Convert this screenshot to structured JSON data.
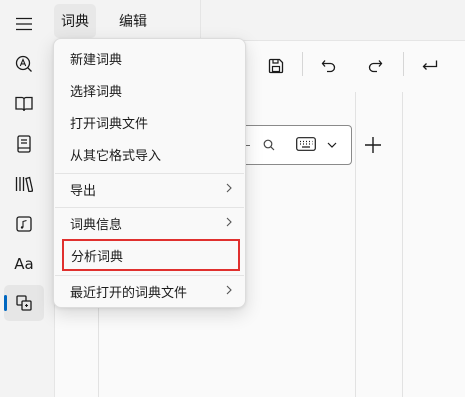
{
  "menubar": {
    "items": [
      {
        "label": "词典"
      },
      {
        "label": "编辑"
      }
    ]
  },
  "rail": {
    "text_icon_label": "Aa"
  },
  "dictionary_menu": {
    "items": [
      {
        "label": "新建词典",
        "submenu": false
      },
      {
        "label": "选择词典",
        "submenu": false
      },
      {
        "label": "打开词典文件",
        "submenu": false
      },
      {
        "label": "从其它格式导入",
        "submenu": false
      },
      {
        "label": "导出",
        "submenu": true
      },
      {
        "label": "词典信息",
        "submenu": true
      },
      {
        "label": "分析词典",
        "submenu": false,
        "highlighted": true
      },
      {
        "label": "最近打开的词典文件",
        "submenu": true
      }
    ]
  },
  "colors": {
    "accent": "#0067c0",
    "highlight_border": "#e0302e",
    "background": "#f3f3f3"
  }
}
